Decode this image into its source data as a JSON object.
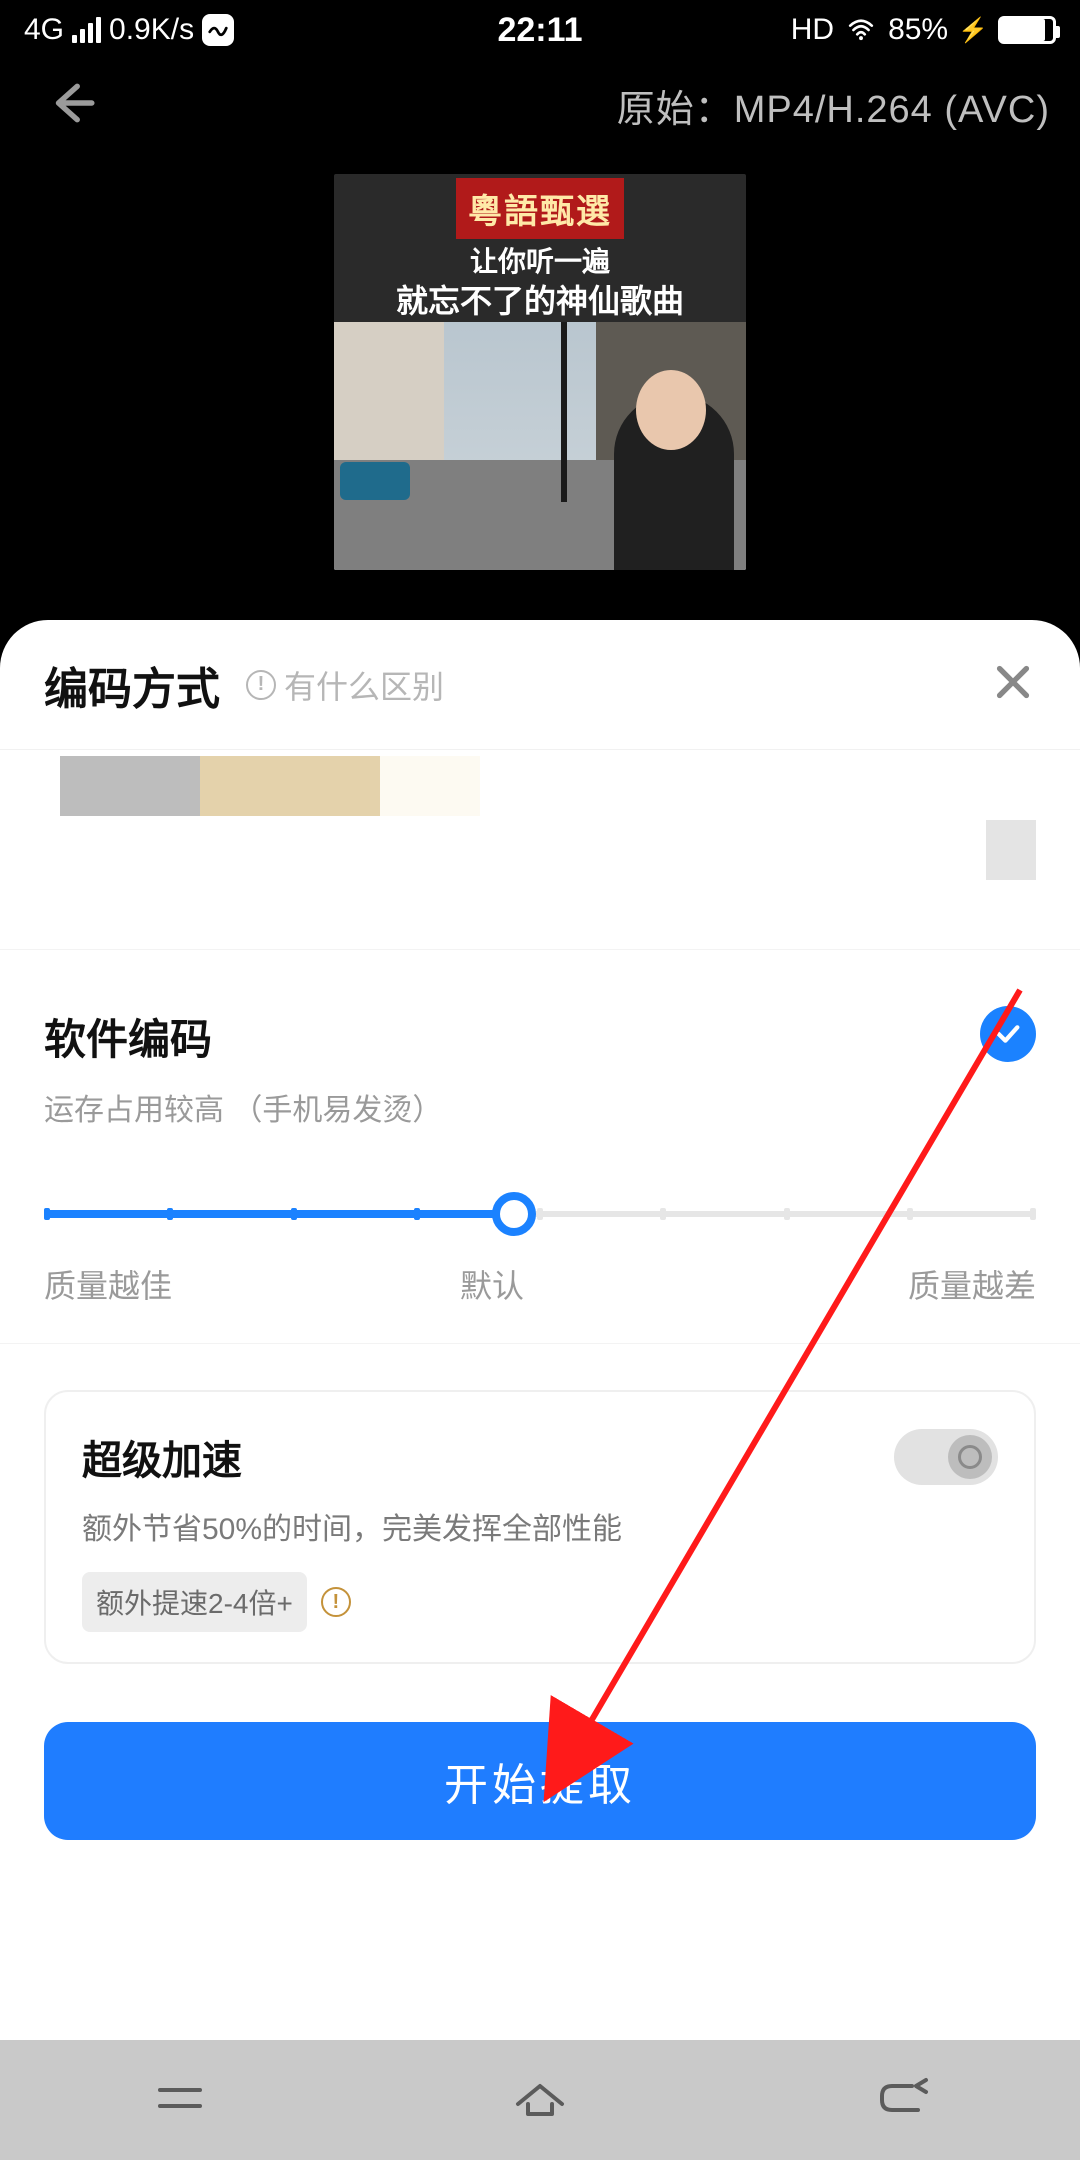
{
  "status": {
    "network": "4G",
    "speed": "0.9K/s",
    "time": "22:11",
    "hd": "HD",
    "battery_pct": "85%"
  },
  "top": {
    "original_label": "原始：",
    "format": "MP4/H.264 (AVC)"
  },
  "thumb": {
    "title": "粵語甄選",
    "line1": "让你听一遍",
    "line2": "就忘不了的神仙歌曲"
  },
  "sheet": {
    "title": "编码方式",
    "help": "有什么区别"
  },
  "encode": {
    "title": "软件编码",
    "subtitle": "运存占用较高 （手机易发烫）",
    "label_left": "质量越佳",
    "label_mid": "默认",
    "label_right": "质量越差"
  },
  "accel": {
    "title": "超级加速",
    "subtitle": "额外节省50%的时间，完美发挥全部性能",
    "badge": "额外提速2-4倍+"
  },
  "action": {
    "start": "开始提取"
  }
}
